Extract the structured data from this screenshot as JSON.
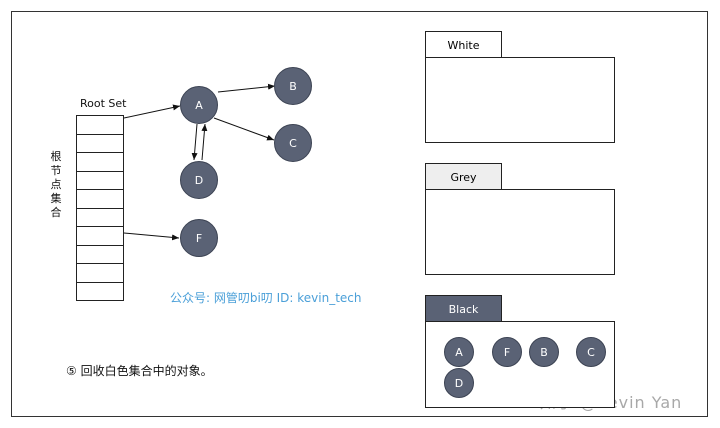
{
  "root_set": {
    "label": "Root Set",
    "vertical_label": "根节点集合",
    "cell_count": 10
  },
  "nodes": [
    "A",
    "B",
    "C",
    "D",
    "F"
  ],
  "watermark": "公众号: 网管叨bi叨  ID: kevin_tech",
  "caption": "⑤  回收白色集合中的对象。",
  "corner_watermark": "知乎 @Kevin Yan",
  "panels": {
    "white": {
      "label": "White",
      "tab_color": "#ffffff"
    },
    "grey": {
      "label": "Grey",
      "tab_color": "#eeeeee"
    },
    "black": {
      "label": "Black",
      "tab_color": "#5a6275",
      "nodes": [
        "A",
        "F",
        "B",
        "C",
        "D"
      ]
    }
  },
  "colors": {
    "node": "#5a6275",
    "watermark": "#4a9fd8"
  }
}
